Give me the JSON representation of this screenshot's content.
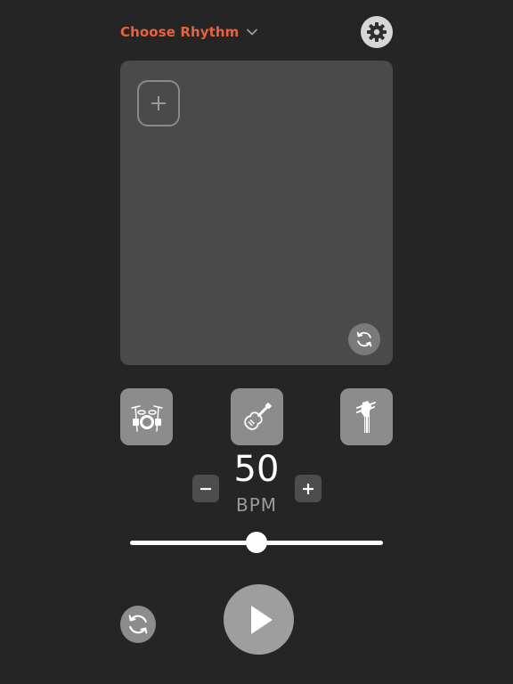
{
  "header": {
    "rhythm_label": "Choose Rhythm"
  },
  "tempo": {
    "bpm_value": "50",
    "bpm_unit": "BPM",
    "slider_level": 0.5
  },
  "icons": {
    "settings": "gear-icon",
    "add_pattern": "plus-icon",
    "pad_refresh": "refresh-icon",
    "drums": "drum-kit-icon",
    "guitar": "electric-guitar-icon",
    "bass": "bass-headstock-icon",
    "decrease": "minus-icon",
    "increase": "plus-icon",
    "reset": "refresh-icon",
    "play": "play-icon"
  },
  "colors": {
    "background": "#252525",
    "accent": "#e8623f",
    "pad": "#4a4a4a",
    "button": "#8c8c8c"
  }
}
